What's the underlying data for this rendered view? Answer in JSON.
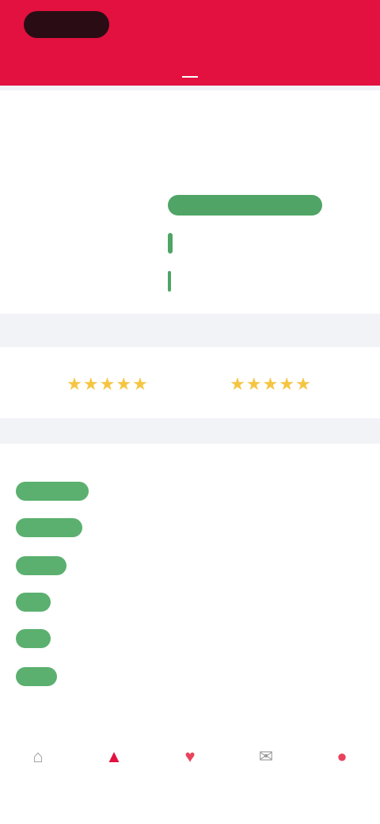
{
  "header": {
    "logo_text": "",
    "actions_text": "",
    "tabs": [
      {
        "label": ""
      },
      {
        "label": ""
      },
      {
        "label": ""
      }
    ]
  },
  "summary": {
    "title": "",
    "rows": [
      {
        "label": "",
        "value": "",
        "fraction": 0.93
      },
      {
        "label": "",
        "value": "",
        "fraction": 0.03
      },
      {
        "label": "",
        "value": "",
        "fraction": 0.02
      }
    ]
  },
  "ratings": [
    {
      "label": "",
      "stars": 4.5,
      "value": ""
    },
    {
      "label": "",
      "stars": 4.5,
      "value": ""
    }
  ],
  "list": {
    "title": "",
    "rows": [
      {
        "label": "",
        "value": "",
        "fraction": 0.23
      },
      {
        "label": "",
        "value": "",
        "fraction": 0.21
      },
      {
        "label": "",
        "value": "",
        "fraction": 0.16
      },
      {
        "label": "",
        "value": "",
        "fraction": 0.11
      },
      {
        "label": "",
        "value": "",
        "fraction": 0.11
      },
      {
        "label": "",
        "value": "",
        "fraction": 0.13
      }
    ],
    "more_label": ""
  },
  "tabbar": [
    {
      "label": "",
      "icon": "home-icon",
      "glyph": "⌂"
    },
    {
      "label": "",
      "icon": "triangle-icon",
      "glyph": "▲"
    },
    {
      "label": "",
      "icon": "heart-icon",
      "glyph": "♥"
    },
    {
      "label": "",
      "icon": "chat-icon",
      "glyph": "✉"
    },
    {
      "label": "",
      "icon": "profile-icon",
      "glyph": "●"
    }
  ],
  "colors": {
    "brand": "#e2113f",
    "bar_green": "#4fa466",
    "star_gold": "#f5c542"
  }
}
